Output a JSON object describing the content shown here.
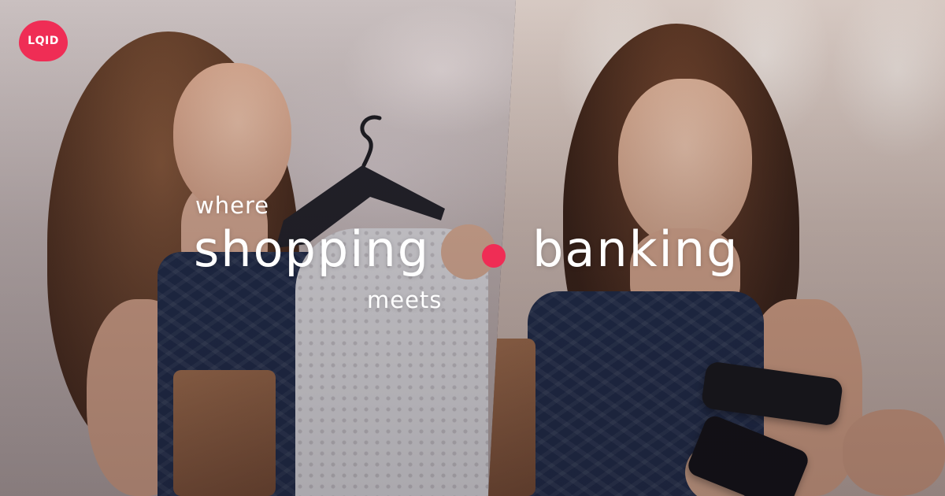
{
  "brand": {
    "logo_text": "LQID",
    "accent_color": "#ef2d55"
  },
  "headline": {
    "word_1": "where",
    "word_2": "shopping",
    "separator_icon": "dot-icon",
    "word_3": "banking",
    "word_4": "meets"
  }
}
